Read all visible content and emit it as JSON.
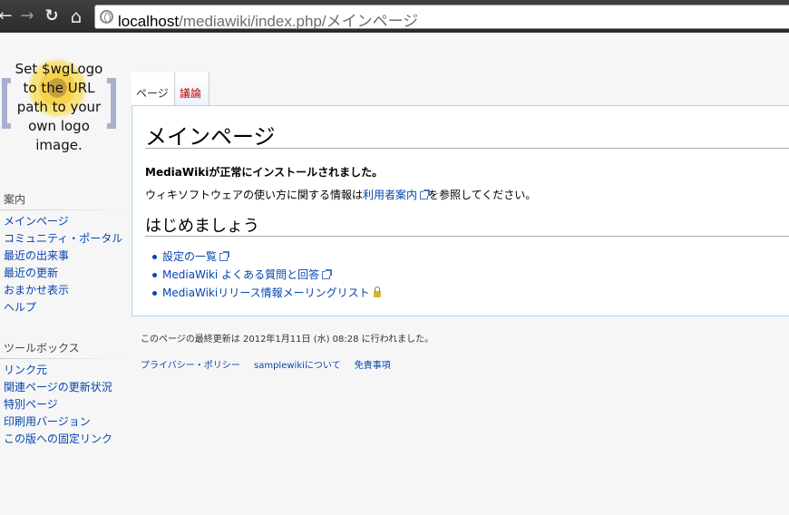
{
  "browser": {
    "back_glyph": "←",
    "forward_glyph": "→",
    "reload_glyph": "↻",
    "home_glyph": "⌂",
    "url_host": "localhost",
    "url_path": "/mediawiki/index.php/メインページ"
  },
  "logo": {
    "line1": "Set $wgLogo",
    "line2": "to the URL",
    "line3": "path to your",
    "line4": "own logo",
    "line5": "image."
  },
  "navigation": {
    "heading": "案内",
    "items": [
      "メインページ",
      "コミュニティ・ポータル",
      "最近の出来事",
      "最近の更新",
      "おまかせ表示",
      "ヘルプ"
    ]
  },
  "toolbox": {
    "heading": "ツールボックス",
    "items": [
      "リンク元",
      "関連ページの更新状況",
      "特別ページ",
      "印刷用バージョン",
      "この版への固定リンク"
    ]
  },
  "tabs": {
    "page": "ページ",
    "talk": "議論"
  },
  "content": {
    "title": "メインページ",
    "installed_message": "MediaWikiが正常にインストールされました。",
    "info_prefix": "ウィキソフトウェアの使い方に関する情報は",
    "info_link": "利用者案内",
    "info_suffix": "を参照してください。",
    "section_heading": "はじめましょう",
    "links": [
      "設定の一覧",
      "MediaWiki よくある質問と回答",
      "MediaWikiリリース情報メーリングリスト"
    ]
  },
  "footer": {
    "last_modified": "このページの最終更新は 2012年1月11日 (水) 08:28 に行われました。",
    "links": [
      "プライバシー・ポリシー",
      "samplewikiについて",
      "免責事項"
    ]
  },
  "colors": {
    "link": "#0645ad",
    "talk_tab": "#ba0000",
    "content_border": "#a7d7f9"
  }
}
